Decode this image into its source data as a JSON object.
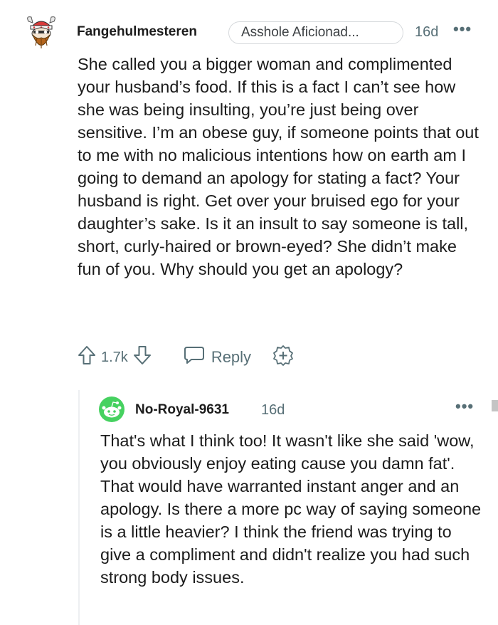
{
  "comment": {
    "author": "Fangehulmesteren",
    "flair": "Asshole Aficionad...",
    "time": "16d",
    "more_label": "•••",
    "avatar_icon": "viking-snoo-avatar-icon",
    "body": "She called you a bigger woman and complimented your husband’s food. If this is a fact I can’t see how she was being insulting, you’re just being over sensitive. I’m an obese guy, if someone points that out to me with no malicious intentions how on earth am I going to demand an apology for stating a fact? Your husband is right. Get over your bruised ego for your daughter’s sake. Is it an insult to say someone is tall, short, curly-haired or brown-eyed? She didn’t make fun of you. Why should you get an apology?",
    "vote_count": "1.7k",
    "reply_label": "Reply",
    "icons": {
      "upvote": "upvote-arrow-icon",
      "downvote": "downvote-arrow-icon",
      "reply": "speech-bubble-icon",
      "award": "award-plus-icon"
    }
  },
  "reply": {
    "author": "No-Royal-9631",
    "time": "16d",
    "more_label": "•••",
    "avatar_icon": "green-snoo-avatar-icon",
    "body": "That's what I think too! It wasn't like she said 'wow, you obviously enjoy eating cause you damn fat'. That would have warranted instant anger and an apology. Is there a more pc way of saying someone is a little heavier? I think the friend was trying to give a compliment and didn't realize you had such strong body issues."
  },
  "colors": {
    "text": "#1c1c1c",
    "meta": "#576f76",
    "border": "#d6d9dc",
    "reply_avatar_green": "#46d160"
  }
}
